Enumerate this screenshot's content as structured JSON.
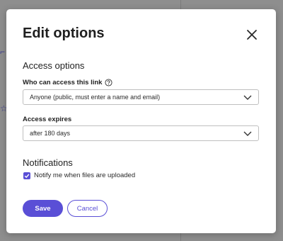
{
  "dialog": {
    "title": "Edit options",
    "access_section_title": "Access options",
    "who_label": "Who can access this link",
    "who_value": "Anyone (public, must enter a name and email)",
    "expires_label": "Access expires",
    "expires_value": "after 180 days",
    "notifications_title": "Notifications",
    "notify_label": "Notify me when files are uploaded",
    "notify_checked": true,
    "save_label": "Save",
    "cancel_label": "Cancel"
  },
  "colors": {
    "accent": "#5a4fd6"
  }
}
